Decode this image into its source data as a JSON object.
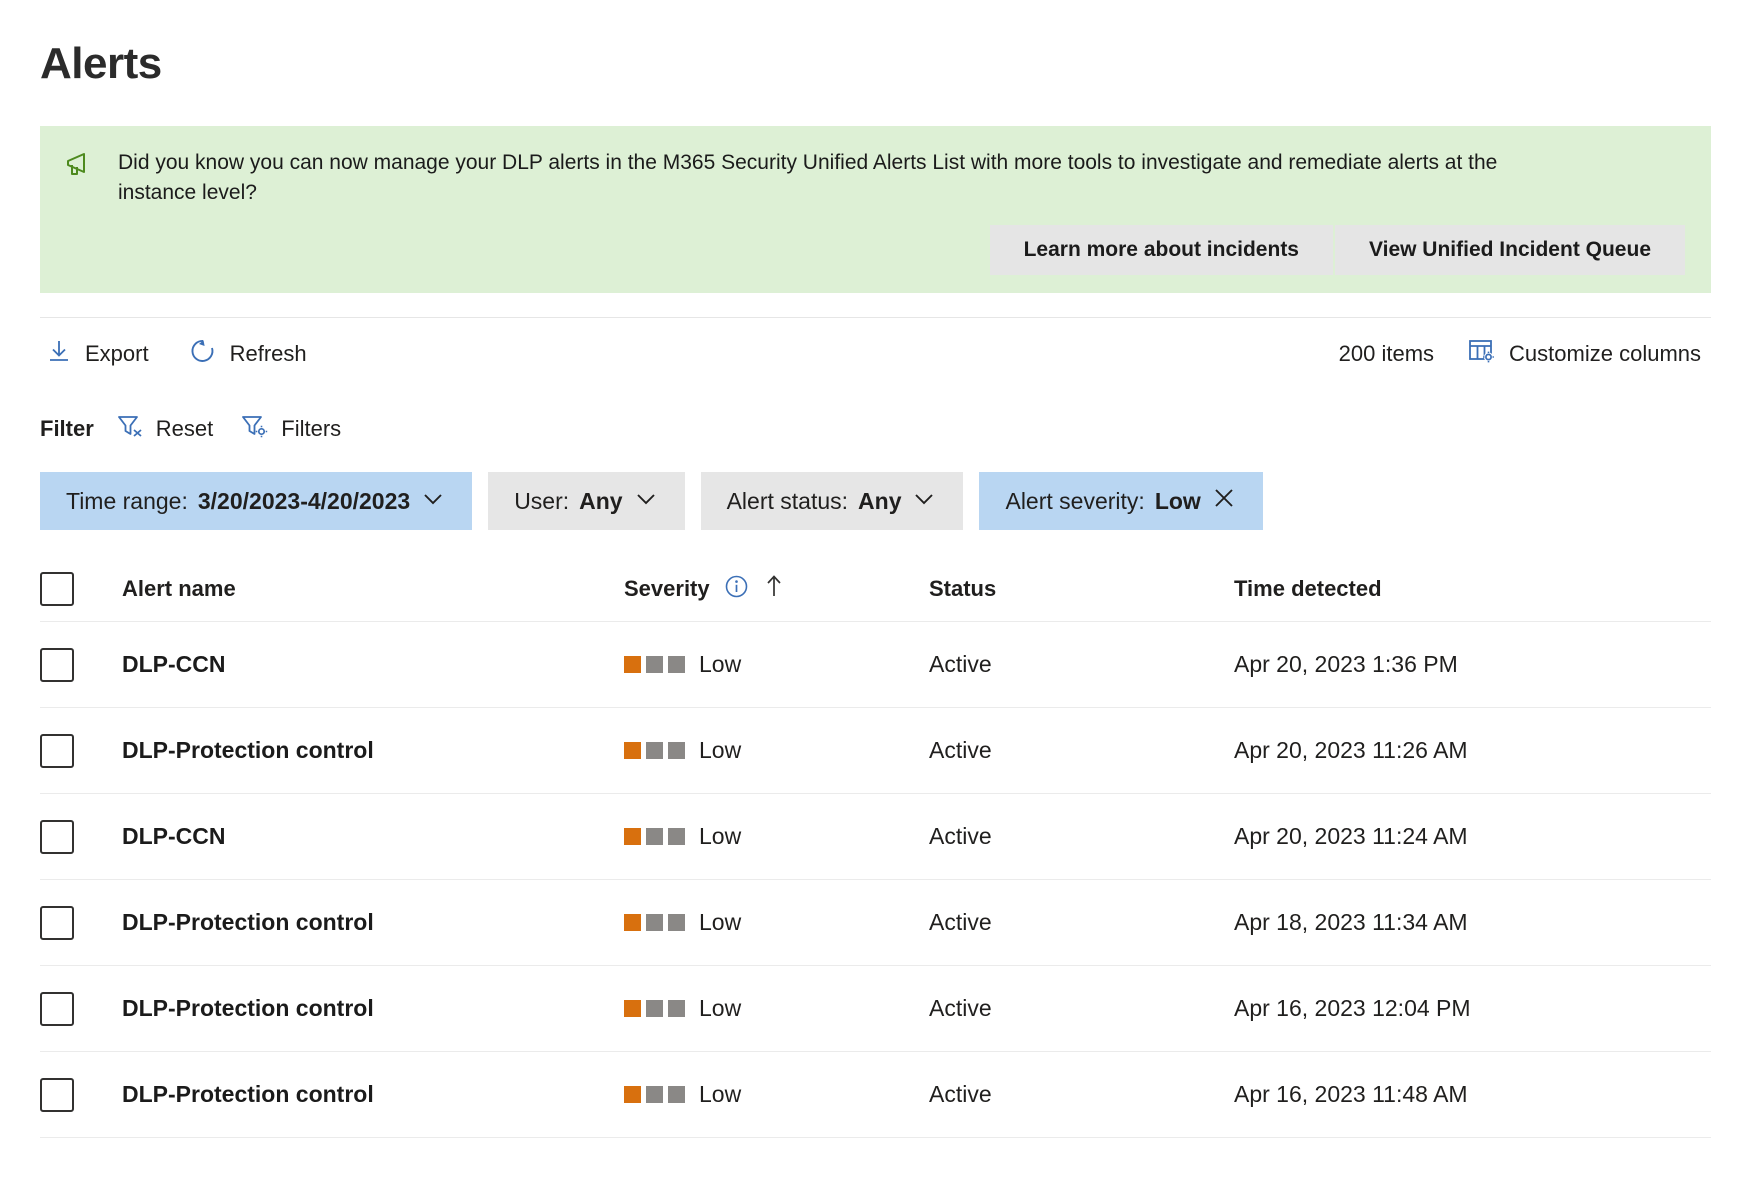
{
  "page_title": "Alerts",
  "banner": {
    "icon": "megaphone-icon",
    "message": "Did you know you can now manage your DLP alerts in the M365 Security Unified Alerts List with more tools to investigate and remediate alerts at the instance level?",
    "buttons": [
      {
        "label": "Learn more about incidents"
      },
      {
        "label": "View Unified Incident Queue"
      }
    ],
    "background_color": "#ddf0d5",
    "icon_color": "#4d8a1e"
  },
  "toolbar": {
    "export_label": "Export",
    "export_icon": "download-arrow-icon",
    "refresh_label": "Refresh",
    "refresh_icon": "refresh-circle-icon",
    "items_count": "200 items",
    "customize_columns_label": "Customize columns",
    "customize_columns_icon": "columns-gear-icon",
    "accent_color": "#3b6fb6"
  },
  "filter": {
    "label": "Filter",
    "reset_label": "Reset",
    "reset_icon": "funnel-clear-icon",
    "filters_label": "Filters",
    "filters_icon": "funnel-gear-icon",
    "pills": [
      {
        "key": "Time range:",
        "value": "3/20/2023-4/20/2023",
        "style": "blue",
        "trailing_icon": "chevron-down-icon"
      },
      {
        "key": "User:",
        "value": "Any",
        "style": "gray",
        "trailing_icon": "chevron-down-icon"
      },
      {
        "key": "Alert status:",
        "value": "Any",
        "style": "gray",
        "trailing_icon": "chevron-down-icon"
      },
      {
        "key": "Alert severity:",
        "value": "Low",
        "style": "blue",
        "trailing_icon": "close-icon"
      }
    ],
    "pill_blue": "#b9d6f2",
    "pill_gray": "#e6e6e6"
  },
  "table": {
    "columns": {
      "name": "Alert name",
      "severity": "Severity",
      "status": "Status",
      "time": "Time detected"
    },
    "severity_info_icon": "info-circle-icon",
    "sort_icon": "sort-ascending-arrow-icon",
    "severity_colors": {
      "filled": "#d8700e",
      "empty": "#8a8886"
    },
    "rows": [
      {
        "name": "DLP-CCN",
        "severity": "Low",
        "severity_level": 1,
        "status": "Active",
        "time": "Apr 20, 2023 1:36 PM"
      },
      {
        "name": "DLP-Protection control",
        "severity": "Low",
        "severity_level": 1,
        "status": "Active",
        "time": "Apr 20, 2023 11:26 AM"
      },
      {
        "name": "DLP-CCN",
        "severity": "Low",
        "severity_level": 1,
        "status": "Active",
        "time": "Apr 20, 2023 11:24 AM"
      },
      {
        "name": "DLP-Protection control",
        "severity": "Low",
        "severity_level": 1,
        "status": "Active",
        "time": "Apr 18, 2023 11:34 AM"
      },
      {
        "name": "DLP-Protection control",
        "severity": "Low",
        "severity_level": 1,
        "status": "Active",
        "time": "Apr 16, 2023 12:04 PM"
      },
      {
        "name": "DLP-Protection control",
        "severity": "Low",
        "severity_level": 1,
        "status": "Active",
        "time": "Apr 16, 2023 11:48 AM"
      }
    ]
  }
}
